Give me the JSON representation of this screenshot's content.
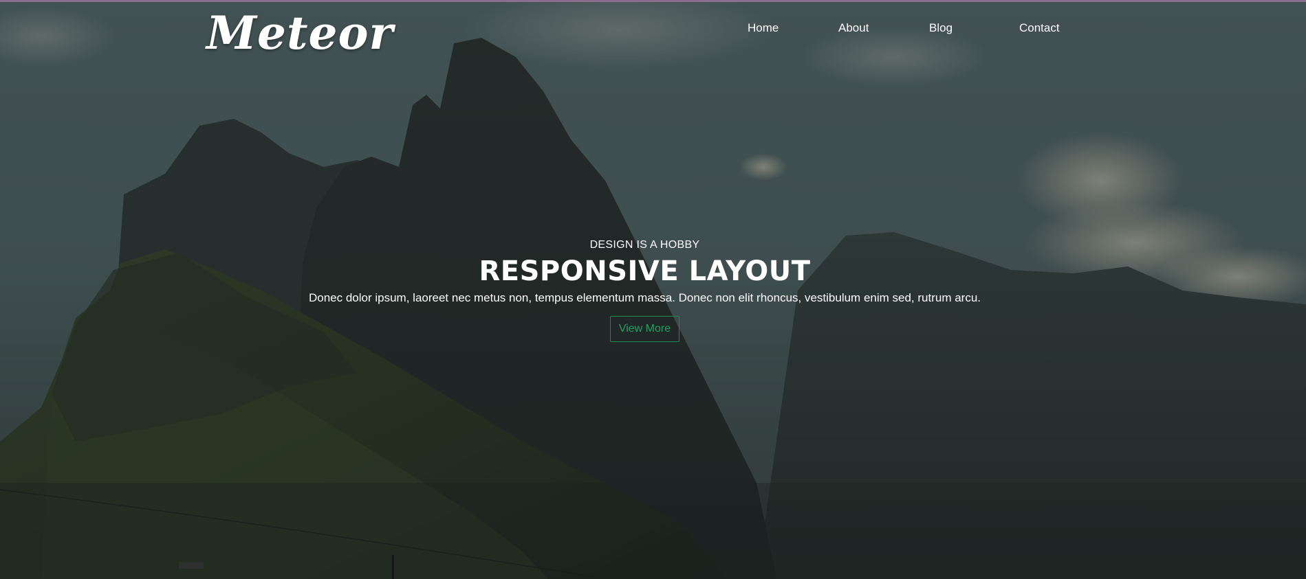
{
  "nav": {
    "logo": "Meteor",
    "items": [
      {
        "label": "Home"
      },
      {
        "label": "About"
      },
      {
        "label": "Blog"
      },
      {
        "label": "Contact"
      }
    ]
  },
  "hero": {
    "tagline": "DESIGN IS A HOBBY",
    "headline": "RESPONSIVE LAYOUT",
    "description": "Donec dolor ipsum, laoreet nec metus non, tempus elementum massa. Donec non elit rhoncus, vestibulum enim sed, rutrum arcu.",
    "button_label": "View More"
  },
  "colors": {
    "accent": "#1d8a52",
    "button_text": "#23a061",
    "text": "#ffffff",
    "top_border": "#8a6e8e"
  }
}
